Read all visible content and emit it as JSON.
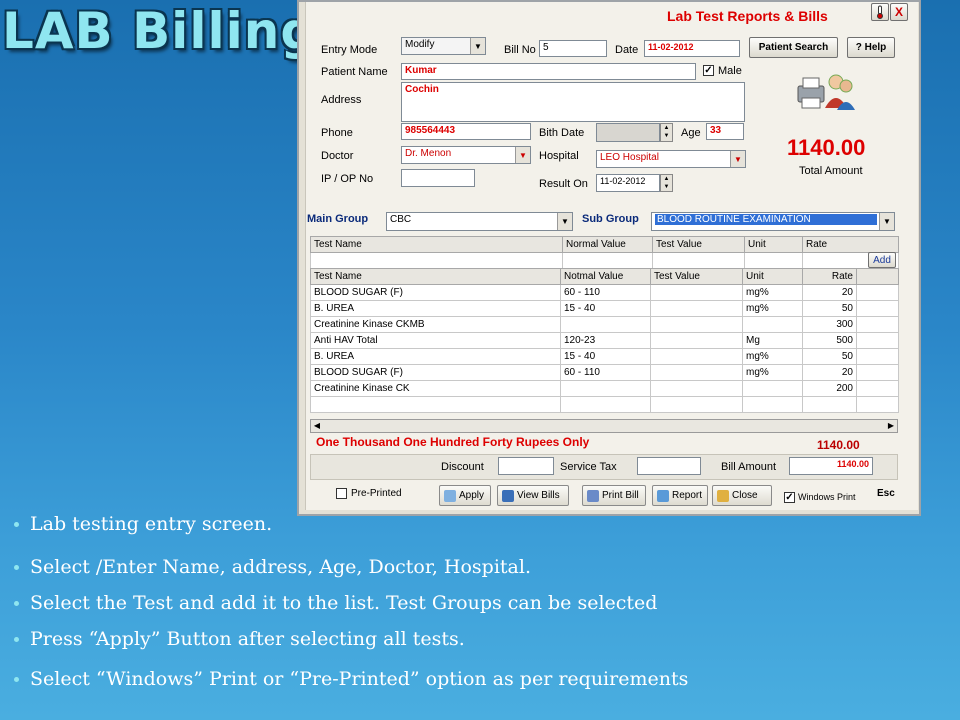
{
  "slide": {
    "title": "LAB Billing"
  },
  "window": {
    "title": "Lab Test Reports & Bills",
    "controls": {
      "thermo_icon": "thermometer-icon",
      "close_label": "X"
    }
  },
  "form": {
    "entry_mode_label": "Entry Mode",
    "entry_mode_value": "Modify",
    "bill_no_label": "Bill No",
    "bill_no_value": "5",
    "date_label": "Date",
    "date_value": "11-02-2012",
    "patient_search_label": "Patient Search",
    "help_label": "? Help",
    "patient_name_label": "Patient Name",
    "patient_name_value": "Kumar",
    "male_label": "Male",
    "address_label": "Address",
    "address_value": "Cochin",
    "phone_label": "Phone",
    "phone_value": "985564443",
    "birth_date_label": "Bith Date",
    "age_label": "Age",
    "age_value": "33",
    "doctor_label": "Doctor",
    "doctor_value": "Dr. Menon",
    "hospital_label": "Hospital",
    "hospital_value": "LEO Hospital",
    "ip_op_label": "IP / OP No",
    "result_on_label": "Result On",
    "result_on_value": "11-02-2012",
    "total_amount_value": "1140.00",
    "total_amount_label": "Total Amount"
  },
  "groups": {
    "main_group_label": "Main Group",
    "main_group_value": "CBC",
    "sub_group_label": "Sub Group",
    "sub_group_value": "BLOOD ROUTINE EXAMINATION"
  },
  "entry_grid": {
    "headers": [
      "Test Name",
      "Normal Value",
      "Test Value",
      "Unit",
      "Rate"
    ],
    "add_label": "Add"
  },
  "table": {
    "headers": [
      "Test Name",
      "Notmal Value",
      "Test Value",
      "Unit",
      "Rate"
    ],
    "rows": [
      [
        "BLOOD SUGAR (F)",
        "60 - 110",
        "",
        "mg%",
        "20"
      ],
      [
        "B. UREA",
        "15 - 40",
        "",
        "mg%",
        "50"
      ],
      [
        "Creatinine Kinase CKMB",
        "",
        "",
        "",
        "300"
      ],
      [
        "Anti HAV Total",
        "120-23",
        "",
        "Mg",
        "500"
      ],
      [
        "B. UREA",
        "15 - 40",
        "",
        "mg%",
        "50"
      ],
      [
        "BLOOD SUGAR (F)",
        "60 - 110",
        "",
        "mg%",
        "20"
      ],
      [
        "Creatinine Kinase CK",
        "",
        "",
        "",
        "200"
      ]
    ]
  },
  "summary": {
    "amount_words": "One Thousand One Hundred Forty  Rupees Only",
    "amount_total": "1140.00",
    "discount_label": "Discount",
    "service_tax_label": "Service Tax",
    "bill_amount_label": "Bill Amount",
    "bill_amount_value": "1140.00"
  },
  "actions": {
    "pre_printed_label": "Pre-Printed",
    "apply_label": "Apply",
    "view_bills_label": "View Bills",
    "print_bill_label": "Print Bill",
    "report_label": "Report",
    "close_label": "Close",
    "windows_print_label": "Windows Print",
    "esc_label": "Esc"
  },
  "bullets": [
    "Lab testing entry screen.",
    "Select /Enter Name, address, Age, Doctor, Hospital.",
    "Select the Test and add it to the list. Test Groups can be selected",
    "Press “Apply” Button after selecting all tests.",
    "Select “Windows” Print or “Pre-Printed” option as per requirements"
  ],
  "colors": {
    "accent_red": "#dd0000",
    "title_cyan": "#8fe6f0",
    "highlight_blue": "#2f6fd6"
  }
}
